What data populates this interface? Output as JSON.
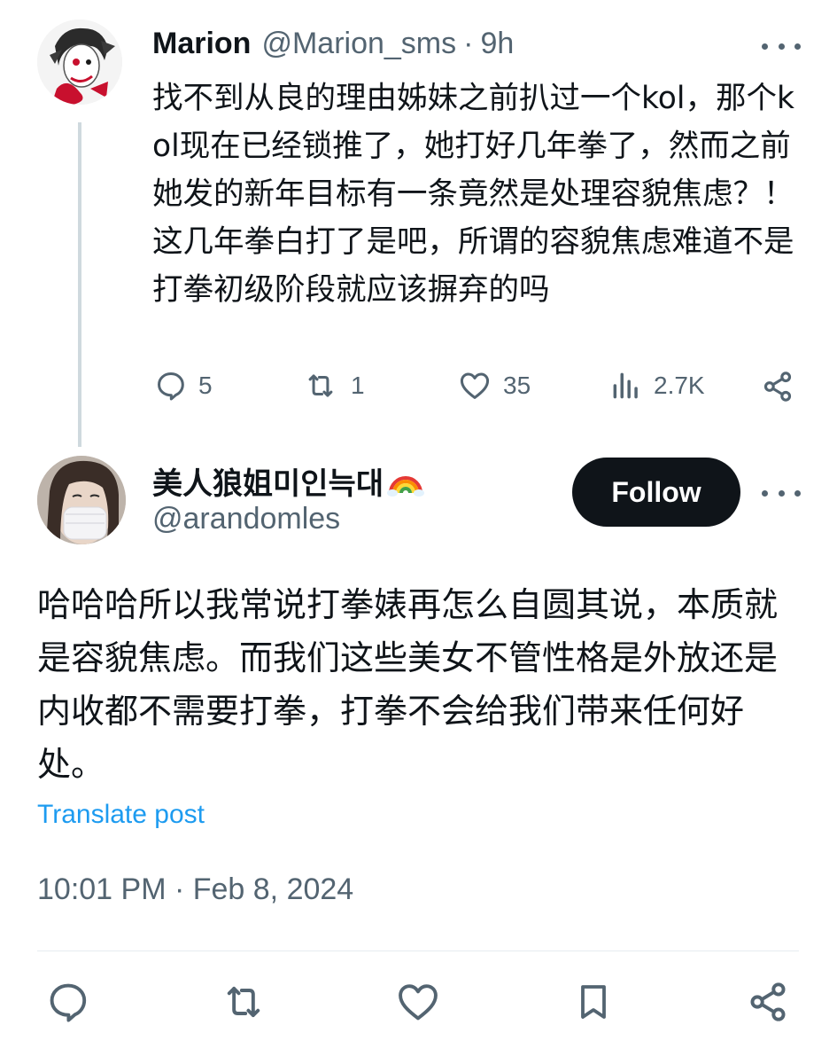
{
  "parent_tweet": {
    "name": "Marion",
    "handle": "@Marion_sms",
    "separator": "·",
    "time": "9h",
    "text": "找不到从良的理由姊妹之前扒过一个kol，那个kol现在已经锁推了，她打好几年拳了，然而之前她发的新年目标有一条竟然是处理容貌焦虑？！ 这几年拳白打了是吧，所谓的容貌焦虑难道不是打拳初级阶段就应该摒弃的吗",
    "actions": {
      "replies": "5",
      "reposts": "1",
      "likes": "35",
      "views": "2.7K"
    }
  },
  "reply_tweet": {
    "name": "美人狼姐미인늑대",
    "name_emoji": "rainbow",
    "handle": "@arandomles",
    "follow_label": "Follow",
    "text": "哈哈哈所以我常说打拳婊再怎么自圆其说，本质就是容貌焦虑。而我们这些美女不管性格是外放还是内收都不需要打拳，打拳不会给我们带来任何好处。",
    "translate_label": "Translate post",
    "timestamp": "10:01 PM · Feb 8, 2024"
  },
  "icons": {
    "reply": "reply-icon",
    "repost": "repost-icon",
    "like": "heart-icon",
    "views": "views-icon",
    "share": "share-icon",
    "bookmark": "bookmark-icon",
    "more": "more-icon"
  },
  "colors": {
    "text": "#0f1419",
    "secondary": "#536471",
    "link": "#1d9bf0",
    "follow_bg": "#0f1419",
    "thread_line": "#cfd9de"
  }
}
